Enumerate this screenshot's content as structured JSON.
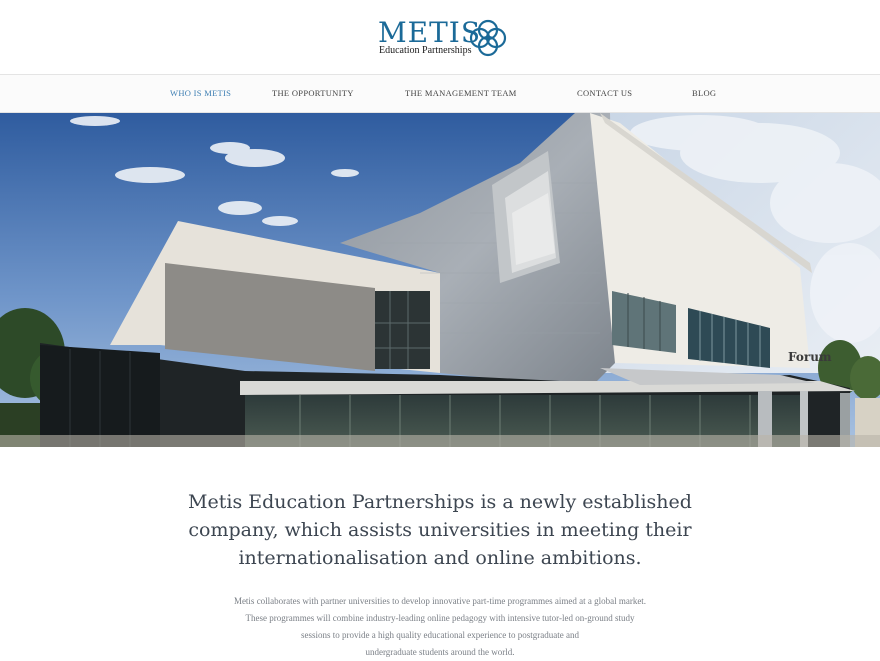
{
  "brand": {
    "name": "METIS",
    "tagline": "Education Partnerships",
    "color": "#1b6a98"
  },
  "nav": {
    "items": [
      {
        "label": "WHO IS METIS",
        "active": true
      },
      {
        "label": "THE OPPORTUNITY",
        "active": false
      },
      {
        "label": "THE MANAGEMENT TEAM",
        "active": false
      },
      {
        "label": "CONTACT US",
        "active": false
      },
      {
        "label": "BLOG",
        "active": false
      }
    ],
    "active_color": "#3e7fb3"
  },
  "hero": {
    "sign_text": "Forum"
  },
  "intro": {
    "headline_lines": [
      "Metis Education Partnerships is a newly established",
      "company, which assists universities in meeting their",
      "internationalisation and online ambitions."
    ],
    "body_lines": [
      "Metis collaborates with partner universities to develop innovative part-time programmes aimed at a global market.",
      "These programmes will combine industry-leading online pedagogy with intensive tutor-led on-ground study",
      "sessions to provide a high quality educational experience to postgraduate and",
      "undergraduate students around the world."
    ]
  }
}
